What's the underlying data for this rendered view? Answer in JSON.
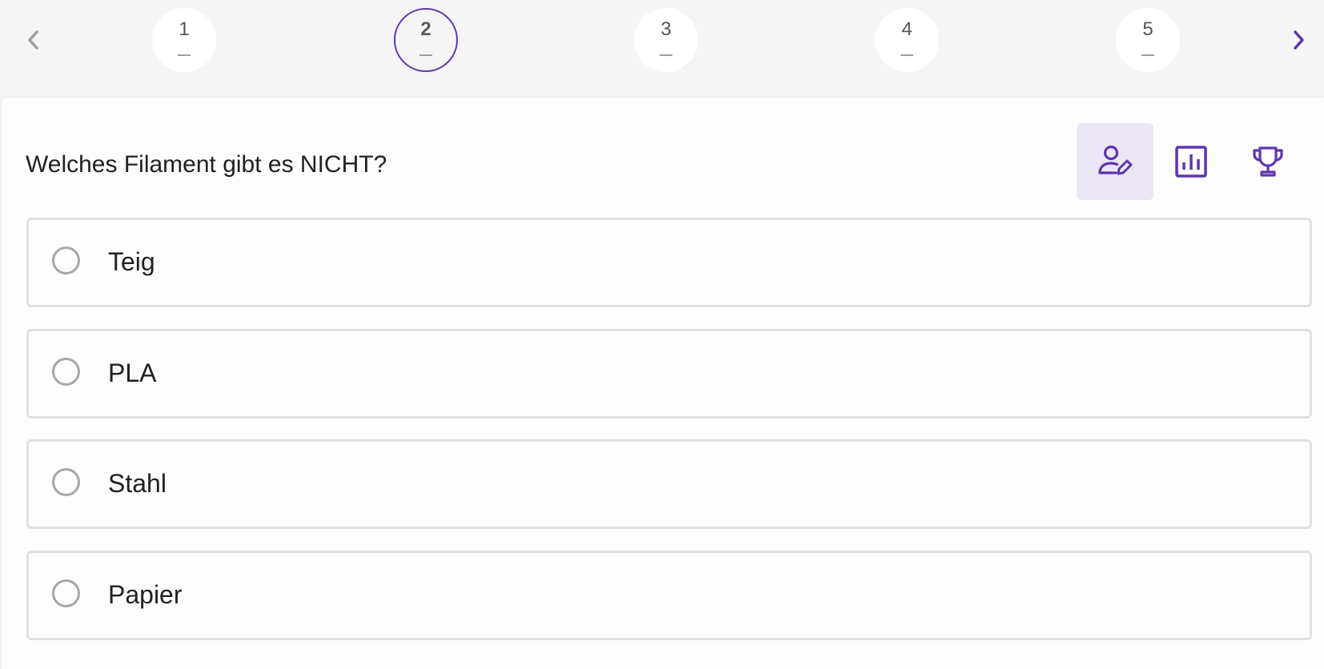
{
  "stepper": {
    "prev_icon": "chevron-left-icon",
    "next_icon": "chevron-right-icon",
    "steps": [
      {
        "number": "1",
        "active": false
      },
      {
        "number": "2",
        "active": true
      },
      {
        "number": "3",
        "active": false
      },
      {
        "number": "4",
        "active": false
      },
      {
        "number": "5",
        "active": false
      }
    ]
  },
  "question": {
    "text": "Welches Filament gibt es NICHT?"
  },
  "toolbar": {
    "items": [
      {
        "icon": "person-edit-icon",
        "active": true
      },
      {
        "icon": "bar-chart-icon",
        "active": false
      },
      {
        "icon": "trophy-icon",
        "active": false
      }
    ]
  },
  "answers": [
    {
      "label": "Teig",
      "selected": false
    },
    {
      "label": "PLA",
      "selected": false
    },
    {
      "label": "Stahl",
      "selected": false
    },
    {
      "label": "Papier",
      "selected": false
    }
  ],
  "colors": {
    "accent": "#5e35b1",
    "active_tool_bg": "#ebe6f5",
    "background": "#f5f5f5",
    "card": "#fdfdfd",
    "border": "#e0e0e0"
  }
}
